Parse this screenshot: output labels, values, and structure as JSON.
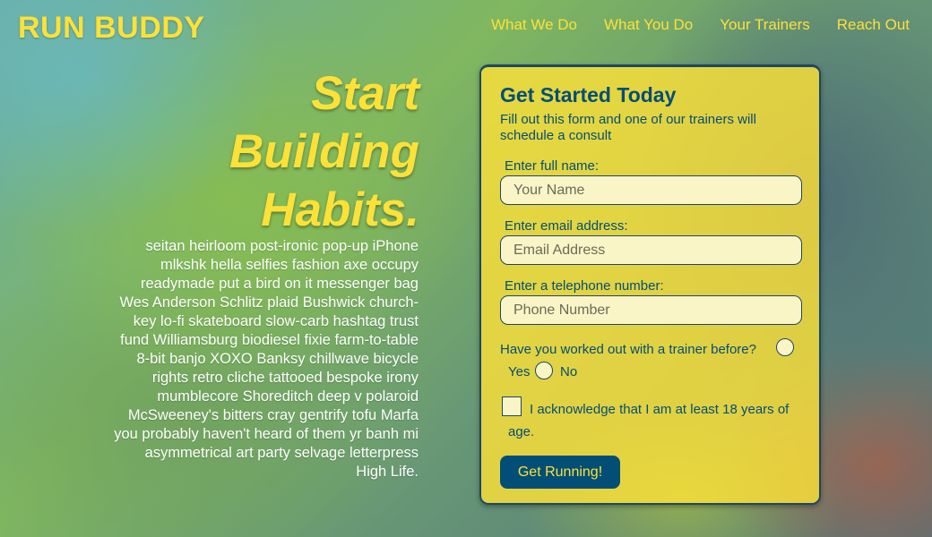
{
  "header": {
    "brand": "RUN BUDDY",
    "nav": [
      "What We Do",
      "What You Do",
      "Your Trainers",
      "Reach Out"
    ]
  },
  "hero": {
    "title_lines": [
      "Start",
      "Building",
      "Habits."
    ],
    "body": "seitan heirloom post-ironic pop-up iPhone mlkshk hella selfies fashion axe occupy readymade put a bird on it messenger bag Wes Anderson Schlitz plaid Bushwick church-key lo-fi skateboard slow-carb hashtag trust fund Williamsburg biodiesel fixie farm-to-table 8-bit banjo XOXO Banksy chillwave bicycle rights retro cliche tattooed bespoke irony mumblecore Shoreditch deep v polaroid McSweeney's bitters cray gentrify tofu Marfa you probably haven't heard of them yr banh mi asymmetrical art party selvage letterpress High Life."
  },
  "form": {
    "title": "Get Started Today",
    "subtitle": "Fill out this form and one of our trainers will schedule a consult",
    "name_label": "Enter full name:",
    "name_placeholder": "Your Name",
    "name_value": "",
    "email_label": "Enter email address:",
    "email_placeholder": "Email Address",
    "email_value": "",
    "phone_label": "Enter a telephone number:",
    "phone_placeholder": "Phone Number",
    "phone_value": "",
    "trainer_question": "Have you worked out with a trainer before?",
    "yes_label": "Yes",
    "no_label": "No",
    "age_ack": "I acknowledge that I am at least 18 years of age.",
    "submit_label": "Get Running!"
  },
  "colors": {
    "accent_yellow": "#fce138",
    "navy": "#024e76"
  }
}
